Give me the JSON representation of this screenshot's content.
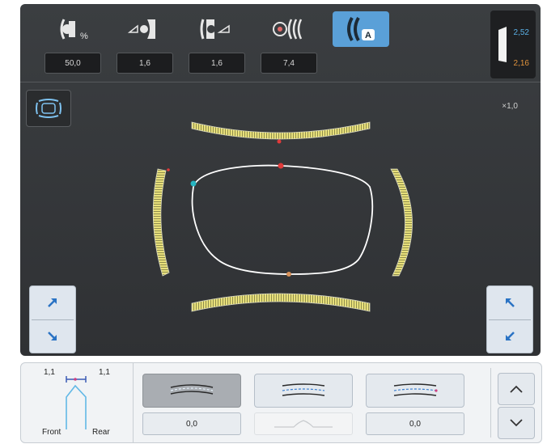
{
  "toolbar": {
    "tools": [
      {
        "icon": "lens-percent-icon",
        "value": "50,0"
      },
      {
        "icon": "front-bevel-icon",
        "value": "1,6"
      },
      {
        "icon": "rear-bevel-icon",
        "value": "1,6"
      },
      {
        "icon": "bevel-curve-icon",
        "value": "7,4"
      },
      {
        "icon": "auto-bevel-icon",
        "active": true,
        "badge": "A"
      }
    ],
    "percent_sign": "%",
    "thickness": {
      "top": "2,52",
      "bottom": "2,16"
    }
  },
  "view": {
    "zoom": "×1,0"
  },
  "profile": {
    "left_value": "1,1",
    "right_value": "1,1",
    "front_label": "Front",
    "rear_label": "Rear"
  },
  "bevel_options": [
    {
      "value": "0,0",
      "selected": true
    },
    {
      "value": "",
      "disabled": true
    },
    {
      "value": "0,0"
    }
  ],
  "colors": {
    "accent": "#5aa0d8",
    "thickness_top": "#5ab0e6",
    "thickness_bottom": "#e0923c",
    "frame": "#ffffff",
    "bevel": "#e8e07a"
  }
}
